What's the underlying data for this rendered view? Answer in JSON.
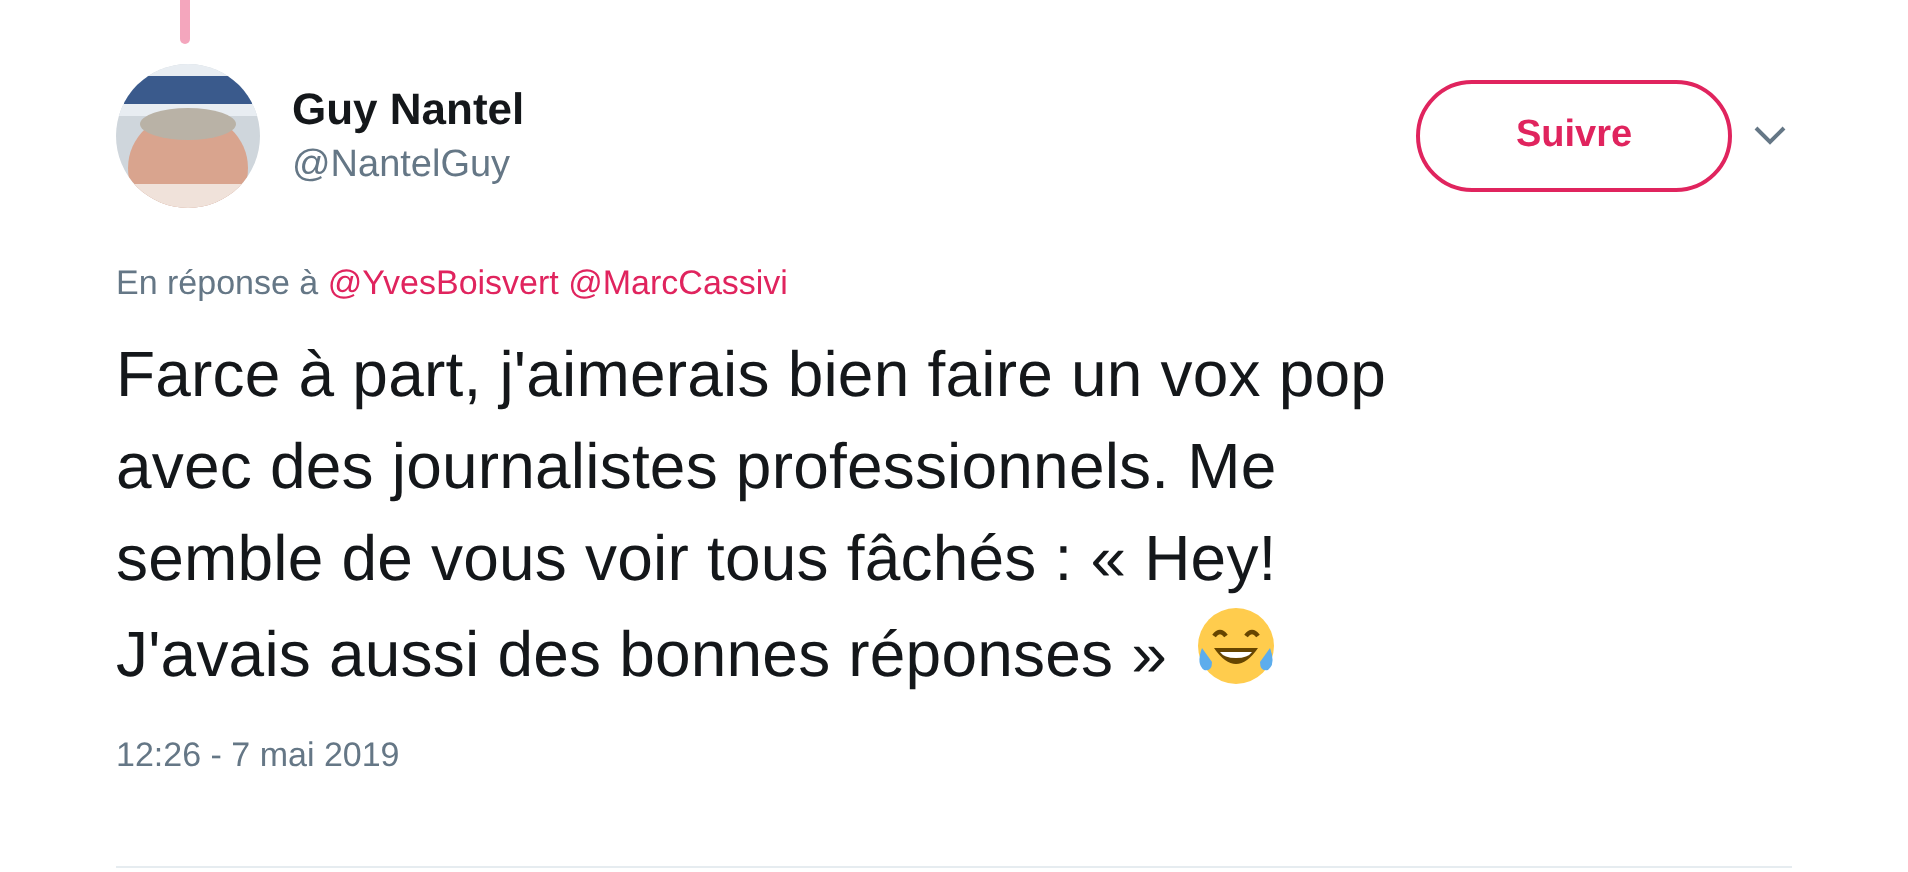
{
  "thread_line": {
    "visible": true
  },
  "author": {
    "name": "Guy Nantel",
    "handle": "@NantelGuy"
  },
  "follow_button": {
    "label": "Suivre"
  },
  "reply_to": {
    "prefix": "En réponse à",
    "mentions": [
      "@YvesBoisvert",
      "@MarcCassivi"
    ]
  },
  "text": "Farce à part, j'aimerais bien faire un vox pop\navec des journalistes professionnels. Me\nsemble de vous voir tous fâchés : « Hey!\nJ'avais aussi des bonnes réponses »",
  "emoji": {
    "kind": "laughing-tears"
  },
  "timestamp": "12:26 - 7 mai 2019"
}
